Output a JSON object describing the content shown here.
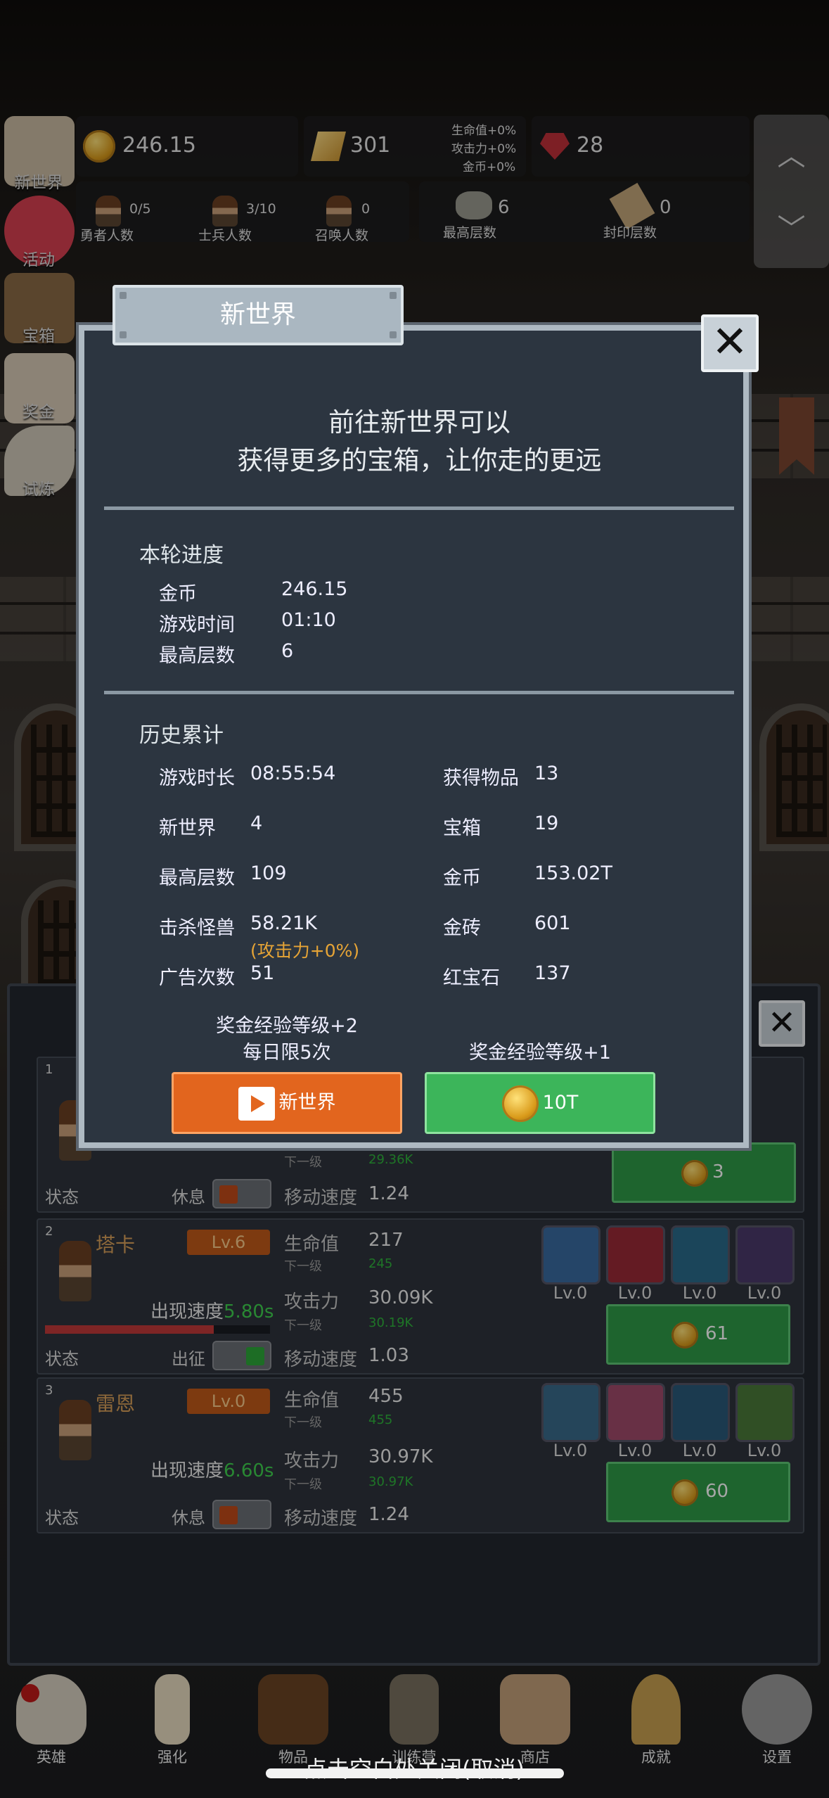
{
  "top_stats": {
    "gold": "246.15",
    "gold_bars": "301",
    "bonus_lines": [
      "生命值+0%",
      "攻击力+0%",
      "金币+0%"
    ],
    "rubies": "28",
    "hero_count": "0/5",
    "hero_label": "勇者人数",
    "soldier_count": "3/10",
    "soldier_label": "士兵人数",
    "summon_count": "0",
    "summon_label": "召唤人数",
    "max_floor": "6",
    "max_floor_label": "最高层数",
    "sealed_floor": "0",
    "sealed_floor_label": "封印层数"
  },
  "side_menu": [
    "新世界",
    "活动",
    "宝箱",
    "奖金",
    "试炼"
  ],
  "modal": {
    "tab_title": "新世界",
    "headline": [
      "前往新世界可以",
      "获得更多的宝箱，让你走的更远"
    ],
    "round": {
      "title": "本轮进度",
      "rows": [
        {
          "label": "金币",
          "value": "246.15"
        },
        {
          "label": "游戏时间",
          "value": "01:10"
        },
        {
          "label": "最高层数",
          "value": "6"
        }
      ]
    },
    "history": {
      "title": "历史累计",
      "left": [
        {
          "label": "游戏时长",
          "value": "08:55:54"
        },
        {
          "label": "新世界",
          "value": "4"
        },
        {
          "label": "最高层数",
          "value": "109"
        },
        {
          "label": "击杀怪兽",
          "value": "58.21K"
        },
        {
          "label": "广告次数",
          "value": "51"
        }
      ],
      "kill_bonus": "(攻击力+0%)",
      "right": [
        {
          "label": "获得物品",
          "value": "13"
        },
        {
          "label": "宝箱",
          "value": "19"
        },
        {
          "label": "金币",
          "value": "153.02T"
        },
        {
          "label": "金砖",
          "value": "601"
        },
        {
          "label": "红宝石",
          "value": "137"
        }
      ]
    },
    "ad_note": [
      "奖金经验等级+2",
      "每日限5次"
    ],
    "ad_button": "新世界",
    "gold_note": "奖金经验等级+1",
    "gold_button": "10T"
  },
  "heroes": [
    {
      "num": "1",
      "state": "状态",
      "action": "休息",
      "next": "下一级",
      "next_val": "29.36K",
      "speed_label": "移动速度",
      "speed": "1.24",
      "cost": "3"
    },
    {
      "num": "2",
      "name": "塔卡",
      "lv": "Lv.6",
      "appear": "出现速度",
      "appear_val": "5.80s",
      "state": "状态",
      "action": "出征",
      "hp_label": "生命值",
      "hp": "217",
      "next": "下一级",
      "hp_next": "245",
      "atk_label": "攻击力",
      "atk": "30.09K",
      "atk_next": "30.19K",
      "speed_label": "移动速度",
      "speed": "1.03",
      "equip": [
        "Lv.0",
        "Lv.0",
        "Lv.0",
        "Lv.0"
      ],
      "cost": "61",
      "hp_fill": 0.75
    },
    {
      "num": "3",
      "name": "雷恩",
      "lv": "Lv.0",
      "appear": "出现速度",
      "appear_val": "6.60s",
      "state": "状态",
      "action": "休息",
      "hp_label": "生命值",
      "hp": "455",
      "next": "下一级",
      "hp_next": "455",
      "atk_label": "攻击力",
      "atk": "30.97K",
      "atk_next": "30.97K",
      "speed_label": "移动速度",
      "speed": "1.24",
      "equip": [
        "Lv.0",
        "Lv.0",
        "Lv.0",
        "Lv.0"
      ],
      "cost": "60"
    }
  ],
  "nav": [
    "英雄",
    "强化",
    "物品",
    "训练营",
    "商店",
    "成就",
    "设置"
  ],
  "hint": "点击空白处关闭(取消)"
}
